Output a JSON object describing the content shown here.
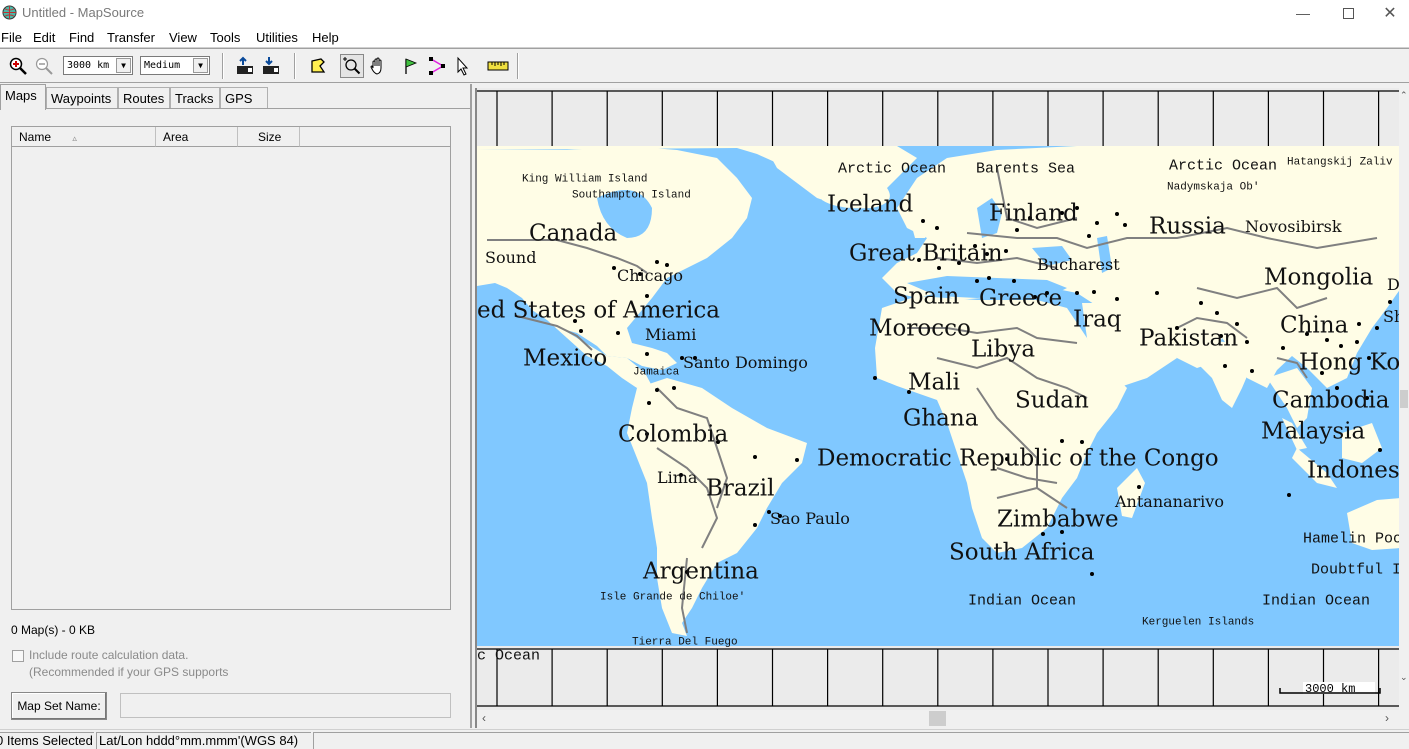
{
  "window": {
    "title": "Untitled - MapSource",
    "minimize_icon": "minimize-icon",
    "maximize_icon": "maximize-icon",
    "close_icon": "close-icon"
  },
  "menu": [
    "File",
    "Edit",
    "Find",
    "Transfer",
    "View",
    "Tools",
    "Utilities",
    "Help"
  ],
  "toolbar": {
    "zoom_in_icon": "zoom-in-icon",
    "zoom_out_icon": "zoom-out-icon",
    "scale_value": "3000 km",
    "detail_value": "Medium",
    "send_to_device_icon": "send-to-device-icon",
    "receive_from_device_icon": "receive-from-device-icon",
    "map_tool_icon": "map-tool-icon",
    "zoom_tool_icon": "zoom-tool-icon",
    "hand_tool_icon": "hand-tool-icon",
    "waypoint_tool_icon": "waypoint-flag-icon",
    "route_tool_icon": "route-tool-icon",
    "selection_tool_icon": "selection-arrow-icon",
    "distance_tool_icon": "ruler-icon"
  },
  "tabs": [
    {
      "label": "Maps",
      "active": true
    },
    {
      "label": "Waypoints",
      "active": false
    },
    {
      "label": "Routes",
      "active": false
    },
    {
      "label": "Tracks",
      "active": false
    },
    {
      "label": "GPS",
      "active": false
    }
  ],
  "maps_panel": {
    "columns": [
      "Name",
      "Area",
      "Size"
    ],
    "sort_indicator": "▵",
    "rows": [],
    "summary": "0 Map(s) - 0 KB",
    "route_checkbox_label": "Include route calculation data.",
    "route_checkbox_note": "(Recommended if your GPS supports",
    "route_checkbox_checked": false,
    "map_set_button": "Map Set Name:",
    "map_set_value": ""
  },
  "map": {
    "colors": {
      "water": "#80c8ff",
      "land": "#fffde6",
      "border": "#808080",
      "grid": "#000000"
    },
    "scale_bar_label": "3000 km",
    "labels": [
      {
        "text": "Arctic Ocean",
        "style": "mono-m"
      },
      {
        "text": "Barents Sea",
        "style": "mono-m"
      },
      {
        "text": "Arctic Ocean",
        "style": "mono-m"
      },
      {
        "text": "Hatangskij Zaliv",
        "style": "mono-s"
      },
      {
        "text": "Nadymskaja Ob'",
        "style": "mono-s"
      },
      {
        "text": "King William Island",
        "style": "mono-s"
      },
      {
        "text": "Southampton Island",
        "style": "mono-s"
      },
      {
        "text": "Canada",
        "style": "serif-l"
      },
      {
        "text": "Sound",
        "style": "serif-m"
      },
      {
        "text": "Iceland",
        "style": "serif-l"
      },
      {
        "text": "Finland",
        "style": "serif-l"
      },
      {
        "text": "Russia",
        "style": "serif-l"
      },
      {
        "text": "Novosibirsk",
        "style": "serif-m"
      },
      {
        "text": "Great Britain",
        "style": "serif-l"
      },
      {
        "text": "Bucharest",
        "style": "serif-m"
      },
      {
        "text": "Chicago",
        "style": "serif-m"
      },
      {
        "text": "Mongolia",
        "style": "serif-l"
      },
      {
        "text": "Spain",
        "style": "serif-l"
      },
      {
        "text": "Greece",
        "style": "serif-l"
      },
      {
        "text": "ed States of America",
        "style": "serif-l"
      },
      {
        "text": "Iraq",
        "style": "serif-l"
      },
      {
        "text": "Morocco",
        "style": "serif-l"
      },
      {
        "text": "China",
        "style": "serif-l"
      },
      {
        "text": "Miami",
        "style": "serif-m"
      },
      {
        "text": "Pakistan",
        "style": "serif-l"
      },
      {
        "text": "Libya",
        "style": "serif-l"
      },
      {
        "text": "Mexico",
        "style": "serif-l"
      },
      {
        "text": "Hong Kon",
        "style": "serif-l"
      },
      {
        "text": "Santo Domingo",
        "style": "serif-m"
      },
      {
        "text": "Jamaica",
        "style": "mono-s"
      },
      {
        "text": "Mali",
        "style": "serif-l"
      },
      {
        "text": "Sudan",
        "style": "serif-l"
      },
      {
        "text": "Cambodia",
        "style": "serif-l"
      },
      {
        "text": "Ghana",
        "style": "serif-l"
      },
      {
        "text": "Colombia",
        "style": "serif-l"
      },
      {
        "text": "Malaysia",
        "style": "serif-l"
      },
      {
        "text": "Democratic Republic of the Congo",
        "style": "serif-l"
      },
      {
        "text": "Indones",
        "style": "serif-l"
      },
      {
        "text": "Lima",
        "style": "serif-m"
      },
      {
        "text": "Brazil",
        "style": "serif-l"
      },
      {
        "text": "Antananarivo",
        "style": "serif-m"
      },
      {
        "text": "Zimbabwe",
        "style": "serif-l"
      },
      {
        "text": "Sao Paulo",
        "style": "serif-m"
      },
      {
        "text": "Hamelin Poo",
        "style": "mono-m"
      },
      {
        "text": "South Africa",
        "style": "serif-l"
      },
      {
        "text": "Argentina",
        "style": "serif-l"
      },
      {
        "text": "Doubtful I",
        "style": "mono-m"
      },
      {
        "text": "Isle Grande de Chiloe'",
        "style": "mono-s"
      },
      {
        "text": "Indian Ocean",
        "style": "mono-m"
      },
      {
        "text": "Indian Ocean",
        "style": "mono-m"
      },
      {
        "text": "Kerguelen Islands",
        "style": "mono-s"
      },
      {
        "text": "Tierra Del Fuego",
        "style": "mono-s"
      },
      {
        "text": "c Ocean",
        "style": "mono-m"
      },
      {
        "text": "D",
        "style": "serif-m"
      },
      {
        "text": "Sh",
        "style": "serif-m"
      }
    ]
  },
  "status": {
    "selection": "0 Items Selected",
    "position_format": "Lat/Lon hddd°mm.mmm'(WGS 84)",
    "extra": ""
  }
}
